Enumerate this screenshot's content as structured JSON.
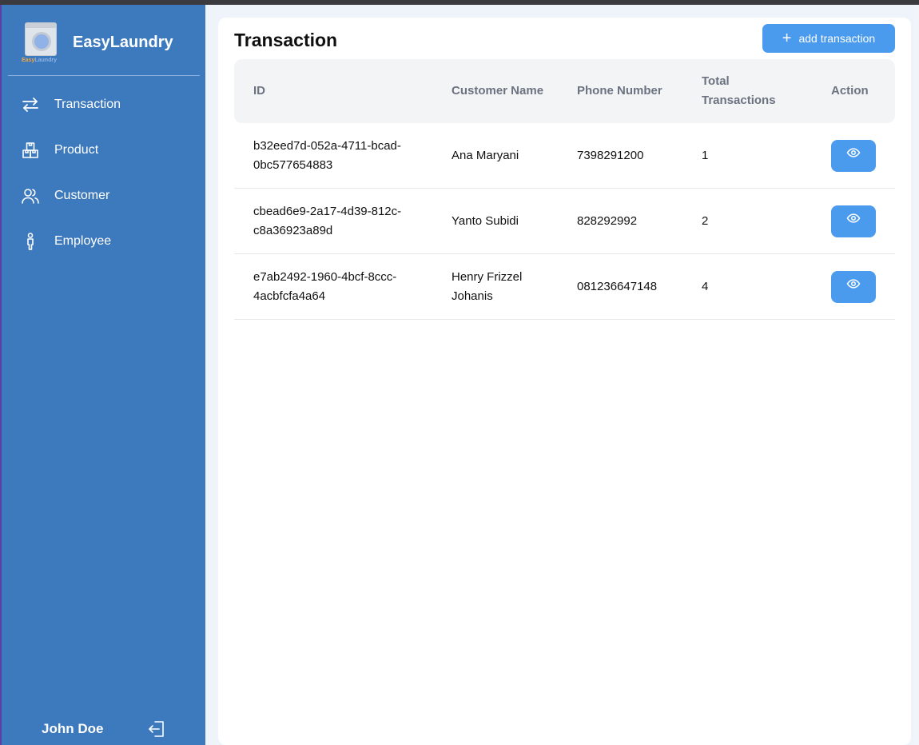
{
  "app": {
    "name": "EasyLaundry",
    "logo_text_a": "Easy",
    "logo_text_b": "Laundry"
  },
  "sidebar": {
    "items": [
      {
        "label": "Transaction",
        "icon": "transfer-arrows-icon"
      },
      {
        "label": "Product",
        "icon": "boxes-icon"
      },
      {
        "label": "Customer",
        "icon": "users-icon"
      },
      {
        "label": "Employee",
        "icon": "person-icon"
      }
    ],
    "user_name": "John Doe",
    "logout_icon": "logout-icon"
  },
  "main": {
    "title": "Transaction",
    "add_button_label": "add transaction",
    "table": {
      "headers": {
        "id": "ID",
        "customer_name": "Customer Name",
        "phone_number": "Phone Number",
        "total_transactions": "Total Transactions",
        "action": "Action"
      },
      "rows": [
        {
          "id": "b32eed7d-052a-4711-bcad-0bc577654883",
          "customer_name": "Ana Maryani",
          "phone_number": "7398291200",
          "total_transactions": "1"
        },
        {
          "id": "cbead6e9-2a17-4d39-812c-c8a36923a89d",
          "customer_name": "Yanto Subidi",
          "phone_number": "828292992",
          "total_transactions": "2"
        },
        {
          "id": "e7ab2492-1960-4bcf-8ccc-4acbfcfa4a64",
          "customer_name": "Henry Frizzel Johanis",
          "phone_number": "081236647148",
          "total_transactions": "4"
        }
      ]
    }
  },
  "colors": {
    "sidebar_bg": "#3d79bd",
    "accent": "#4a9aed",
    "table_header_bg": "#f3f4f6",
    "page_bg": "#eff4fb"
  }
}
